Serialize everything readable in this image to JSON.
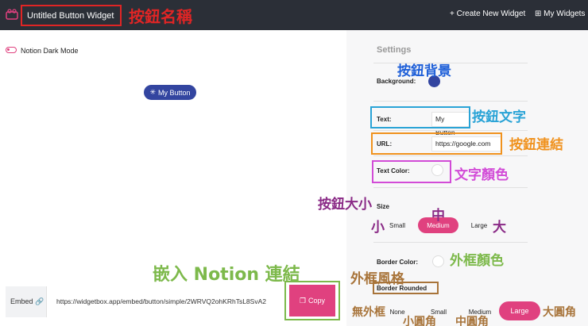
{
  "header": {
    "widget_title": "Untitled Button Widget",
    "create_label": "+ Create New Widget",
    "widgets_label": "My Widgets"
  },
  "preview": {
    "dark_mode_label": "Notion Dark Mode",
    "button_label": "My Button"
  },
  "embed": {
    "label": "Embed",
    "url": "https://widgetbox.app/embed/button/simple/2WRVQ2ohKRhTsL8SvA2",
    "copy_label": "Copy"
  },
  "settings": {
    "title": "Settings",
    "background_label": "Background:",
    "text_label": "Text:",
    "text_value": "My Button",
    "url_label": "URL:",
    "url_value": "https://google.com",
    "text_color_label": "Text Color:",
    "size_label": "Size",
    "size_options": [
      "Small",
      "Medium",
      "Large"
    ],
    "border_color_label": "Border Color:",
    "border_rounded_label": "Border Rounded",
    "rounded_options": [
      "None",
      "Small",
      "Medium",
      "Large"
    ]
  },
  "annotations": {
    "button_name": "按鈕名稱",
    "button_bg": "按鈕背景",
    "button_text": "按鈕文字",
    "button_link": "按鈕連結",
    "text_color": "文字顏色",
    "button_size": "按鈕大小",
    "size_small": "小",
    "size_medium": "中",
    "size_large": "大",
    "border_color": "外框顏色",
    "embed_notion": "嵌入 Notion 連結",
    "border_style": "外框風格",
    "no_border": "無外框",
    "small_round": "小圓角",
    "medium_round": "中圓角",
    "large_round": "大圓角"
  },
  "colors": {
    "accent": "#e0417f",
    "button_bg": "#3345a0",
    "header_bg": "#2b2f37"
  }
}
